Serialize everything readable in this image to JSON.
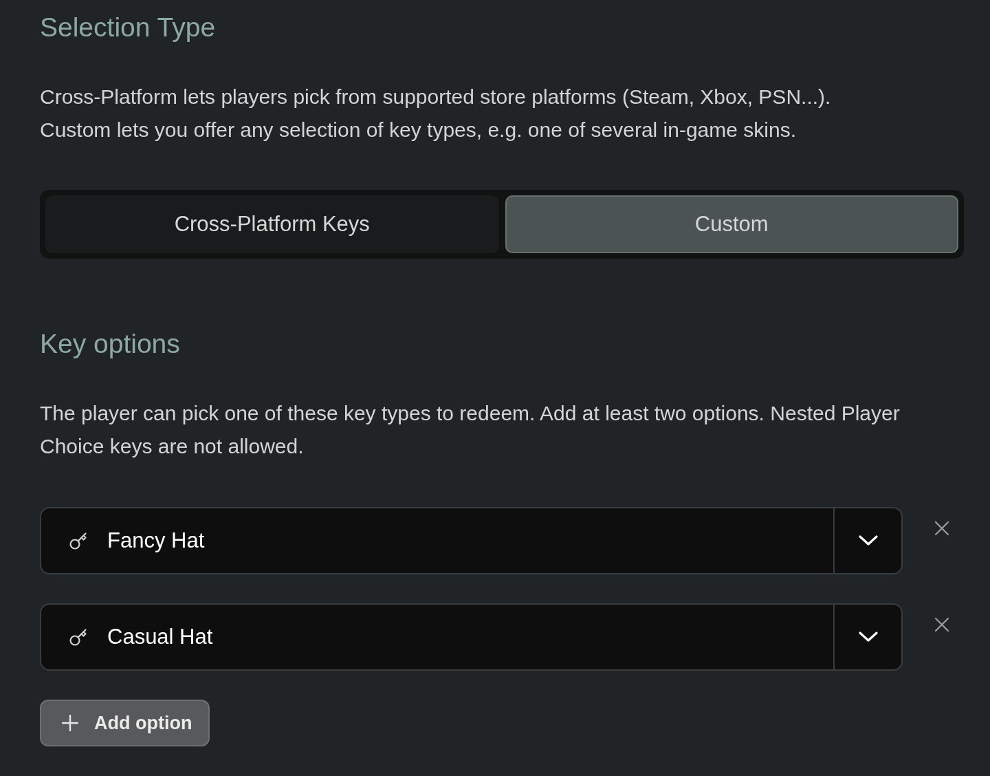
{
  "selection_type": {
    "title": "Selection Type",
    "description": [
      "Cross-Platform lets players pick from supported store platforms (Steam, Xbox, PSN...).",
      "Custom lets you offer any selection of key types, e.g. one of several in-game skins."
    ],
    "options": [
      {
        "label": "Cross-Platform Keys",
        "selected": false
      },
      {
        "label": "Custom",
        "selected": true
      }
    ]
  },
  "key_options": {
    "title": "Key options",
    "description": "The player can pick one of these key types to redeem. Add at least two options. Nested Player Choice keys are not allowed.",
    "items": [
      {
        "value": "Fancy Hat"
      },
      {
        "value": "Casual Hat"
      }
    ],
    "add_button": "Add option"
  }
}
